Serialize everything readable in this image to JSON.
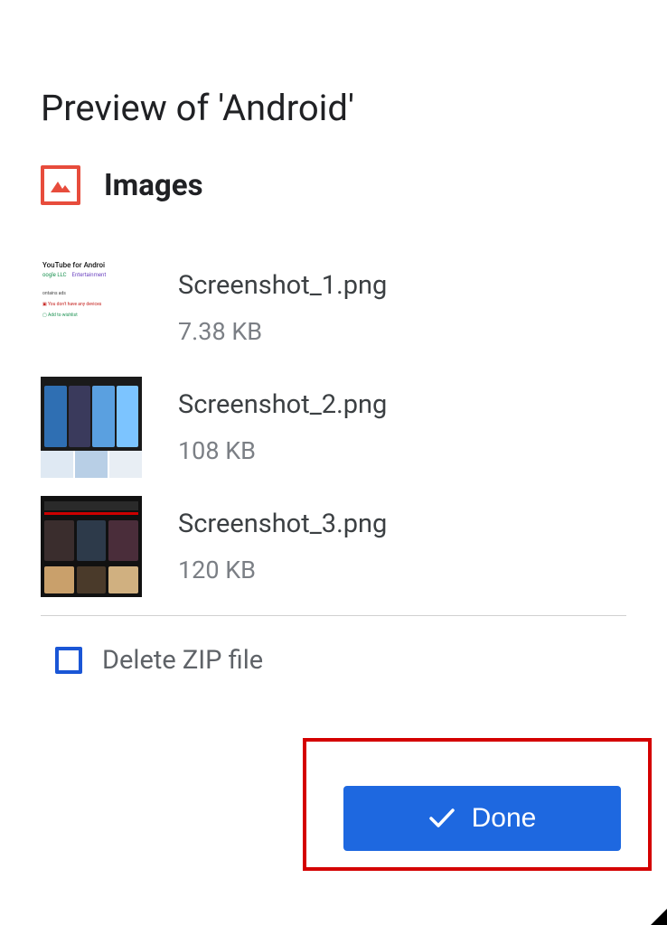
{
  "title": "Preview of 'Android'",
  "section": {
    "label": "Images",
    "icon": "image-icon",
    "icon_color": "#e74c3c"
  },
  "files": [
    {
      "name": "Screenshot_1.png",
      "size": "7.38 KB"
    },
    {
      "name": "Screenshot_2.png",
      "size": "108 KB"
    },
    {
      "name": "Screenshot_3.png",
      "size": "120 KB"
    }
  ],
  "delete_zip": {
    "checked": false,
    "label": "Delete ZIP file"
  },
  "done": {
    "label": "Done",
    "highlight_color": "#d40000",
    "button_color": "#1e68e0"
  }
}
